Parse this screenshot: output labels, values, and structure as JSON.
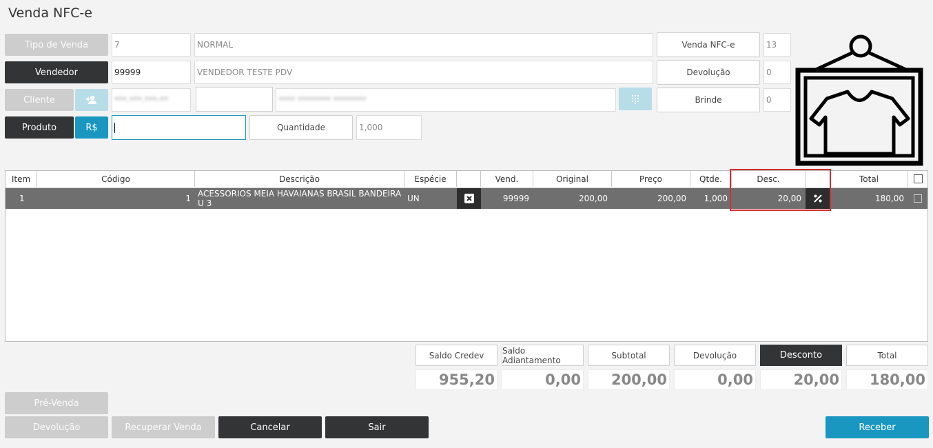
{
  "page": {
    "title": "Venda NFC-e"
  },
  "form": {
    "tipo_venda": {
      "label": "Tipo de Venda",
      "code": "7",
      "desc": "NORMAL"
    },
    "vendedor": {
      "label": "Vendedor",
      "code": "99999",
      "desc": "VENDEDOR TESTE PDV"
    },
    "cliente": {
      "label": "Cliente",
      "code": "***.***.***-**",
      "desc": "**** ******** ********"
    },
    "produto": {
      "label": "Produto",
      "price_label": "R$",
      "value": ""
    },
    "quantidade": {
      "label": "Quantidade",
      "value": "1,000"
    }
  },
  "right_panel": {
    "venda_nfce": {
      "label": "Venda NFC-e",
      "value": "13"
    },
    "devolucao": {
      "label": "Devolução",
      "value": "0"
    },
    "brinde": {
      "label": "Brinde",
      "value": "0"
    }
  },
  "table": {
    "headers": {
      "item": "Item",
      "codigo": "Código",
      "descricao": "Descrição",
      "especie": "Espécie",
      "vend": "Vend.",
      "original": "Original",
      "preco": "Preço",
      "qtde": "Qtde.",
      "desc": "Desc.",
      "total": "Total"
    },
    "rows": [
      {
        "item": "1",
        "codigo": "1",
        "descricao": "ACESSORIOS MEIA HAVAIANAS BRASIL BANDEIRA U 3",
        "especie": "UN",
        "vend": "99999",
        "original": "200,00",
        "preco": "200,00",
        "qtde": "1,000",
        "desc": "20,00",
        "total": "180,00"
      }
    ]
  },
  "summary": {
    "saldo_credev": {
      "label": "Saldo Credev",
      "value": "955,20"
    },
    "saldo_adiantamento": {
      "label": "Saldo Adiantamento",
      "value": "0,00"
    },
    "subtotal": {
      "label": "Subtotal",
      "value": "200,00"
    },
    "devolucao": {
      "label": "Devolução",
      "value": "0,00"
    },
    "desconto": {
      "label": "Desconto",
      "value": "20,00"
    },
    "total": {
      "label": "Total",
      "value": "180,00"
    }
  },
  "footer": {
    "pre_venda": "Pré-Venda",
    "devolucao": "Devolução",
    "recuperar_venda": "Recuperar Venda",
    "cancelar": "Cancelar",
    "sair": "Sair",
    "receber": "Receber"
  },
  "icons": {
    "add_client": "add-user-icon",
    "keypad": "keypad-icon",
    "remove_item": "close-box-icon",
    "discount": "percent-icon",
    "product_image": "hanging-tshirt-icon"
  },
  "colors": {
    "dark_button": "#333436",
    "accent_blue": "#1a97c1",
    "selected_row": "#6f6f6f",
    "highlight": "#d62c2c"
  }
}
